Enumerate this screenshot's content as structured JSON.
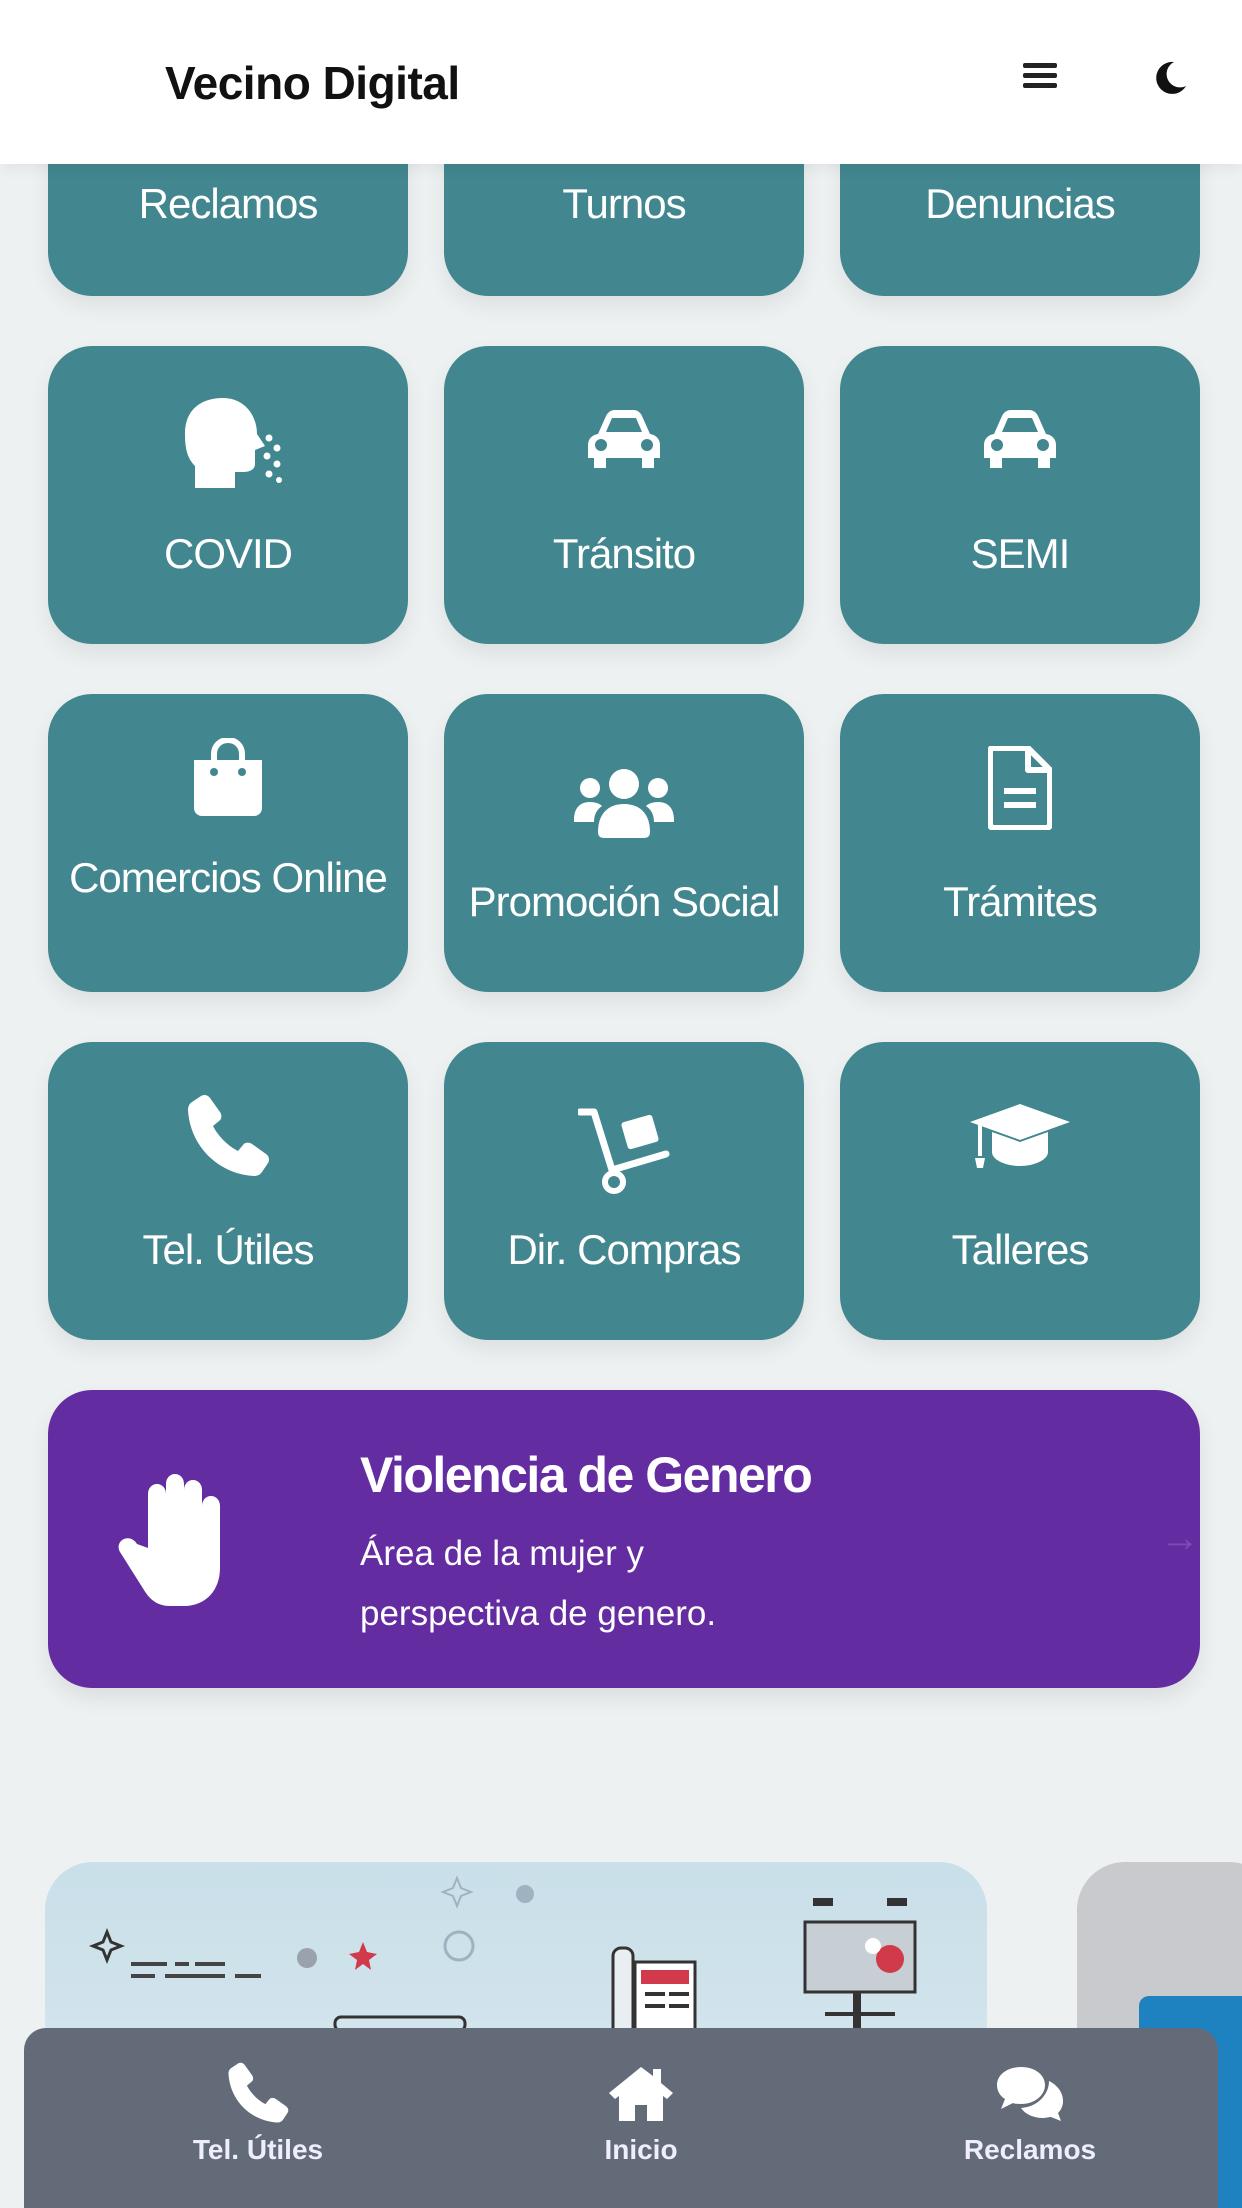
{
  "header": {
    "title": "Vecino Digital",
    "menu_icon": "hamburger-icon",
    "theme_icon": "moon-icon"
  },
  "tiles": [
    {
      "label": "Reclamos",
      "icon": ""
    },
    {
      "label": "Turnos",
      "icon": ""
    },
    {
      "label": "Denuncias",
      "icon": ""
    },
    {
      "label": "COVID",
      "icon": "head-cough-icon"
    },
    {
      "label": "Tránsito",
      "icon": "car-icon"
    },
    {
      "label": "SEMI",
      "icon": "car-icon"
    },
    {
      "label": "Comercios Online",
      "icon": "shopping-bag-icon"
    },
    {
      "label": "Promoción Social",
      "icon": "users-icon"
    },
    {
      "label": "Trámites",
      "icon": "file-alt-icon"
    },
    {
      "label": "Tel. Útiles",
      "icon": "phone-icon"
    },
    {
      "label": "Dir. Compras",
      "icon": "dolly-icon"
    },
    {
      "label": "Talleres",
      "icon": "graduation-cap-icon"
    }
  ],
  "banner": {
    "title": "Violencia de Genero",
    "subtitle": "Área de la mujer y perspectiva de genero.",
    "icon": "hand-paper-icon",
    "color": "#642ca1"
  },
  "bottom_nav": [
    {
      "label": "Tel. Útiles",
      "icon": "phone-icon"
    },
    {
      "label": "Inicio",
      "icon": "home-icon"
    },
    {
      "label": "Reclamos",
      "icon": "comments-icon"
    }
  ],
  "colors": {
    "tile": "#42868f",
    "nav": "#646b78",
    "background": "#eef1f1"
  }
}
